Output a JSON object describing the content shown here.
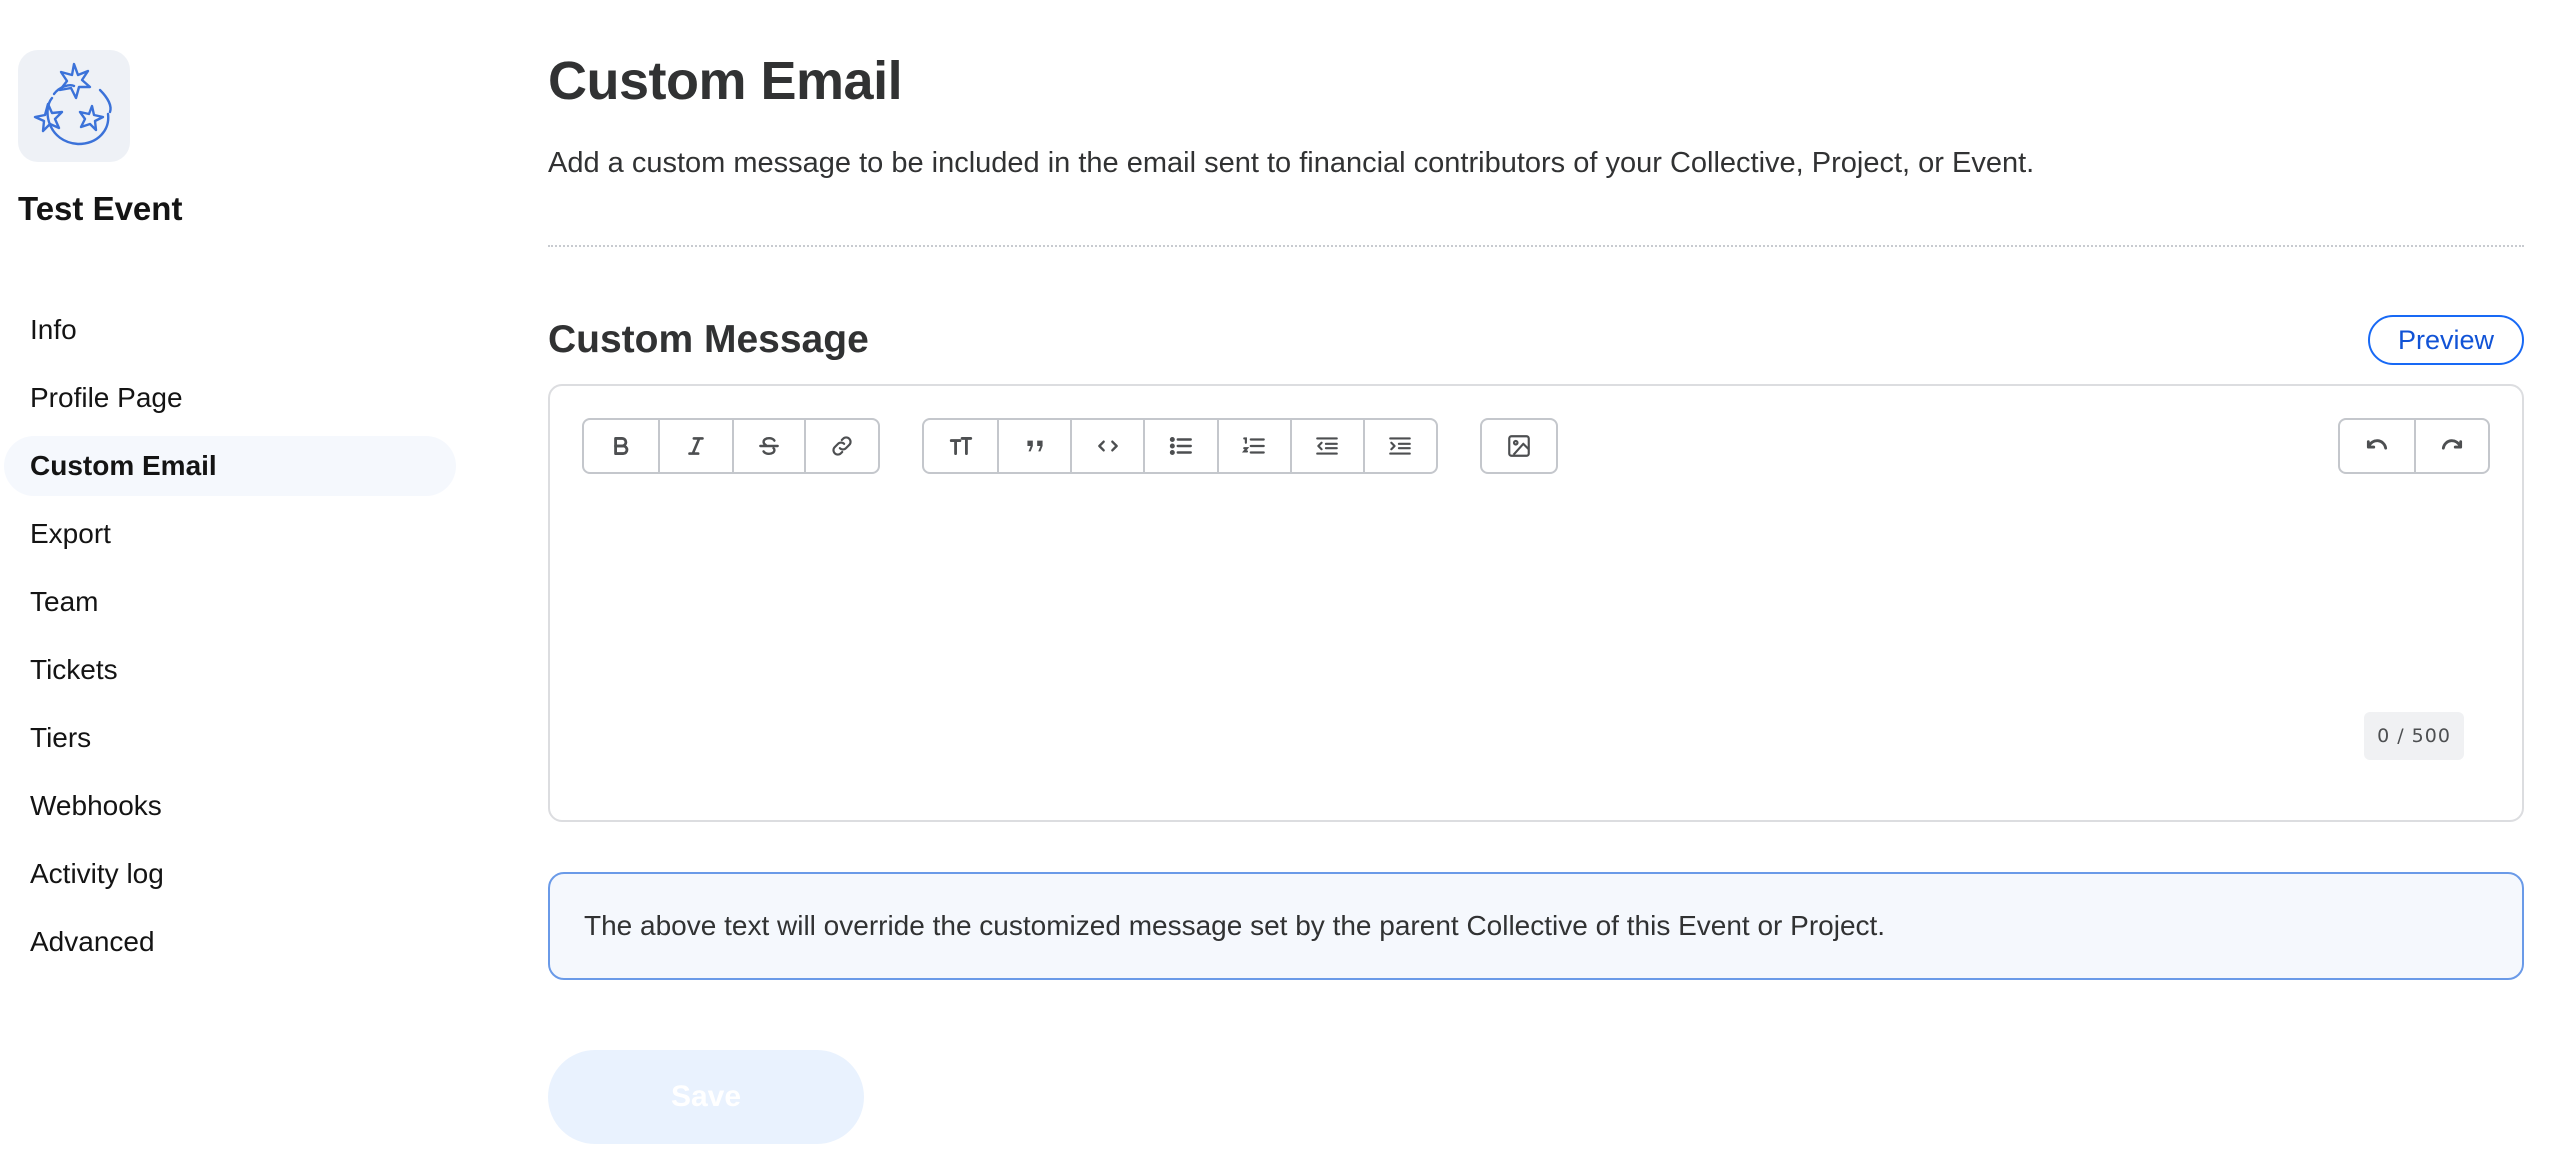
{
  "sidebar": {
    "account_name": "Test Event",
    "items": [
      {
        "label": "Info",
        "active": false
      },
      {
        "label": "Profile Page",
        "active": false
      },
      {
        "label": "Custom Email",
        "active": true
      },
      {
        "label": "Export",
        "active": false
      },
      {
        "label": "Team",
        "active": false
      },
      {
        "label": "Tickets",
        "active": false
      },
      {
        "label": "Tiers",
        "active": false
      },
      {
        "label": "Webhooks",
        "active": false
      },
      {
        "label": "Activity log",
        "active": false
      },
      {
        "label": "Advanced",
        "active": false
      }
    ]
  },
  "main": {
    "title": "Custom Email",
    "description": "Add a custom message to be included in the email sent to financial contributors of your Collective, Project, or Event.",
    "section_title": "Custom Message",
    "preview_label": "Preview",
    "editor": {
      "toolbar": {
        "text_format": [
          "bold-icon",
          "italic-icon",
          "strikethrough-icon",
          "link-icon"
        ],
        "blocks": [
          "heading-icon",
          "quote-icon",
          "code-icon",
          "bullet-list-icon",
          "numbered-list-icon",
          "outdent-icon",
          "indent-icon"
        ],
        "media": [
          "image-icon"
        ],
        "history": [
          "undo-icon",
          "redo-icon"
        ]
      },
      "content": "",
      "char_count": "0 / 500"
    },
    "info_message": "The above text will override the customized message set by the parent Collective of this Event or Project.",
    "save_label": "Save"
  },
  "colors": {
    "accent": "#1869f5",
    "active_nav_bg": "#f5f8fd",
    "info_border": "#6a9ae8",
    "save_disabled_bg": "#e9f2fe"
  }
}
